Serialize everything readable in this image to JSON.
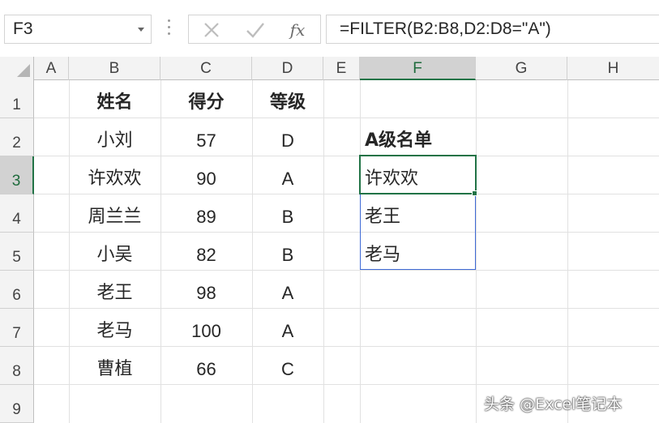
{
  "formula_bar": {
    "name_box": "F3",
    "insert_function_label": "fx",
    "formula": "=FILTER(B2:B8,D2:D8=\"A\")"
  },
  "columns": [
    "A",
    "B",
    "C",
    "D",
    "E",
    "F",
    "G",
    "H"
  ],
  "rows": [
    "1",
    "2",
    "3",
    "4",
    "5",
    "6",
    "7",
    "8",
    "9"
  ],
  "table": {
    "headers": {
      "name": "姓名",
      "score": "得分",
      "grade": "等级"
    },
    "records": [
      {
        "name": "小刘",
        "score": "57",
        "grade": "D"
      },
      {
        "name": "许欢欢",
        "score": "90",
        "grade": "A"
      },
      {
        "name": "周兰兰",
        "score": "89",
        "grade": "B"
      },
      {
        "name": "小吴",
        "score": "82",
        "grade": "B"
      },
      {
        "name": "老王",
        "score": "98",
        "grade": "A"
      },
      {
        "name": "老马",
        "score": "100",
        "grade": "A"
      },
      {
        "name": "曹植",
        "score": "66",
        "grade": "C"
      }
    ]
  },
  "result": {
    "title": "A级名单",
    "values": [
      "许欢欢",
      "老王",
      "老马"
    ]
  },
  "active_cell": "F3",
  "watermark": "头条 @Excel笔记本",
  "colors": {
    "selection": "#217346",
    "spill": "#3f6bd6",
    "header_bg": "#f3f3f3"
  }
}
